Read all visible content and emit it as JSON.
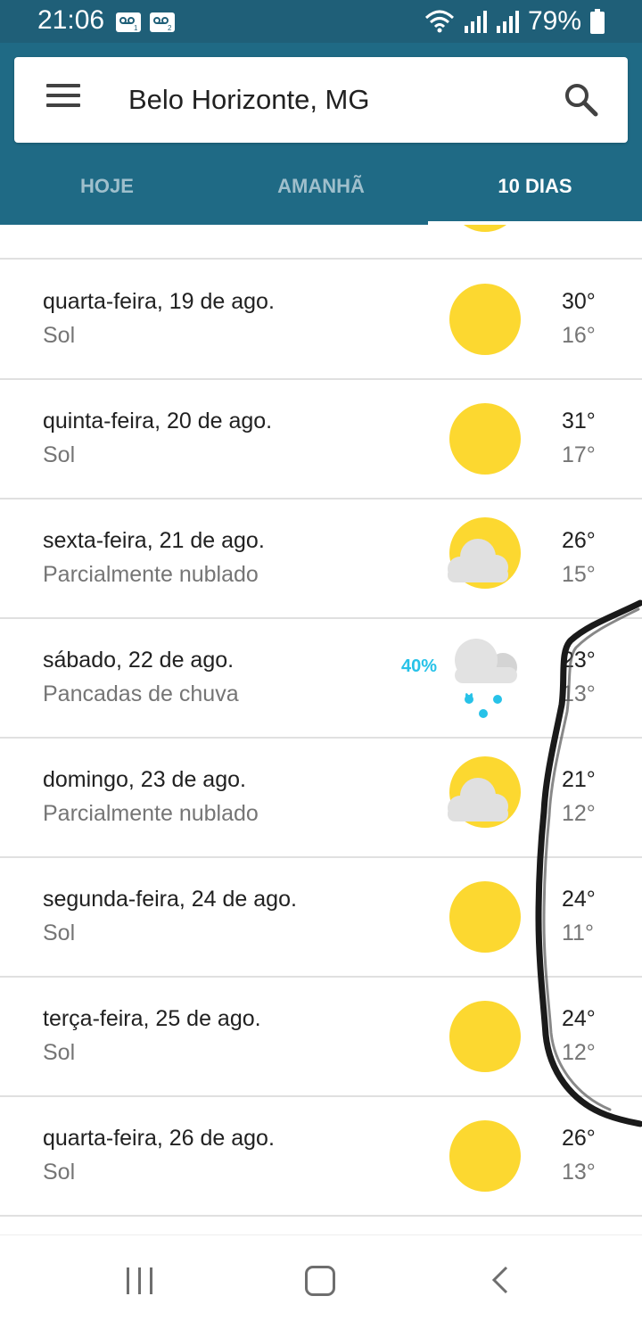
{
  "status_bar": {
    "time": "21:06",
    "battery": "79%",
    "icons": [
      "voicemail-1-icon",
      "voicemail-2-icon",
      "wifi-icon",
      "signal-1-icon",
      "signal-2-icon",
      "battery-icon"
    ]
  },
  "header": {
    "location": "Belo Horizonte, MG",
    "tabs": [
      {
        "label": "HOJE",
        "active": false
      },
      {
        "label": "AMANHÃ",
        "active": false
      },
      {
        "label": "10 DIAS",
        "active": true
      }
    ]
  },
  "forecast": [
    {
      "date": "quarta-feira, 19 de ago.",
      "condition": "Sol",
      "icon": "sun-icon",
      "high": "30°",
      "low": "16°",
      "precip": ""
    },
    {
      "date": "quinta-feira, 20 de ago.",
      "condition": "Sol",
      "icon": "sun-icon",
      "high": "31°",
      "low": "17°",
      "precip": ""
    },
    {
      "date": "sexta-feira, 21 de ago.",
      "condition": "Parcialmente nublado",
      "icon": "partly-cloudy-icon",
      "high": "26°",
      "low": "15°",
      "precip": ""
    },
    {
      "date": "sábado, 22 de ago.",
      "condition": "Pancadas de chuva",
      "icon": "rain-cloud-icon",
      "high": "23°",
      "low": "13°",
      "precip": "40%"
    },
    {
      "date": "domingo, 23 de ago.",
      "condition": "Parcialmente nublado",
      "icon": "partly-cloudy-icon",
      "high": "21°",
      "low": "12°",
      "precip": ""
    },
    {
      "date": "segunda-feira, 24 de ago.",
      "condition": "Sol",
      "icon": "sun-icon",
      "high": "24°",
      "low": "11°",
      "precip": ""
    },
    {
      "date": "terça-feira, 25 de ago.",
      "condition": "Sol",
      "icon": "sun-icon",
      "high": "24°",
      "low": "12°",
      "precip": ""
    },
    {
      "date": "quarta-feira, 26 de ago.",
      "condition": "Sol",
      "icon": "sun-icon",
      "high": "26°",
      "low": "13°",
      "precip": ""
    }
  ],
  "colors": {
    "app_bar": "#1f6a85",
    "status_bar": "#1f5f78",
    "sun": "#fcd830",
    "precip": "#27c2e8"
  },
  "nav_bar": {
    "icons": [
      "recent-apps-icon",
      "home-icon",
      "back-icon"
    ]
  }
}
